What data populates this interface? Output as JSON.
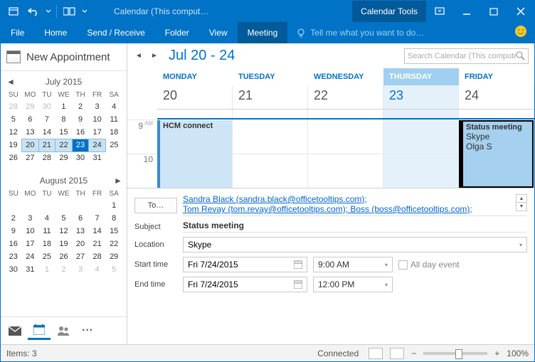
{
  "title": "Calendar (This comput…",
  "context_tab": "Calendar Tools",
  "ribbon": {
    "tabs": [
      "File",
      "Home",
      "Send / Receive",
      "Folder",
      "View",
      "Meeting"
    ],
    "active": "Meeting",
    "tellme": "Tell me what you want to do…"
  },
  "left": {
    "new": "New Appointment",
    "cal1": {
      "title": "July 2015",
      "dow": [
        "SU",
        "MO",
        "TU",
        "WE",
        "TH",
        "FR",
        "SA"
      ],
      "cells": [
        [
          "28",
          "29",
          "30",
          "1",
          "2",
          "3",
          "4"
        ],
        [
          "5",
          "6",
          "7",
          "8",
          "9",
          "10",
          "11"
        ],
        [
          "12",
          "13",
          "14",
          "15",
          "16",
          "17",
          "18"
        ],
        [
          "19",
          "20",
          "21",
          "22",
          "23",
          "24",
          "25"
        ],
        [
          "26",
          "27",
          "28",
          "29",
          "30",
          "31",
          ""
        ]
      ]
    },
    "cal2": {
      "title": "August 2015",
      "dow": [
        "SU",
        "MO",
        "TU",
        "WE",
        "TH",
        "FR",
        "SA"
      ],
      "cells": [
        [
          "",
          "",
          "",
          "",
          "",
          "",
          "1"
        ],
        [
          "2",
          "3",
          "4",
          "5",
          "6",
          "7",
          "8"
        ],
        [
          "9",
          "10",
          "11",
          "12",
          "13",
          "14",
          "15"
        ],
        [
          "16",
          "17",
          "18",
          "19",
          "20",
          "21",
          "22"
        ],
        [
          "23",
          "24",
          "25",
          "26",
          "27",
          "28",
          "29"
        ],
        [
          "30",
          "31",
          "1",
          "2",
          "3",
          "4",
          "5"
        ]
      ]
    }
  },
  "week": {
    "range": "Jul 20 - 24",
    "search": "Search Calendar (This computer only) (…",
    "days": [
      "MONDAY",
      "TUESDAY",
      "WEDNESDAY",
      "THURSDAY",
      "FRIDAY"
    ],
    "nums": [
      "20",
      "21",
      "22",
      "23",
      "24"
    ],
    "times": {
      "t1": "9",
      "t1s": "AM",
      "t2": "10"
    },
    "evt1": {
      "title": "HCM connect"
    },
    "evt2": {
      "title": "Status meeting",
      "loc": "Skype",
      "who": "Olga S"
    }
  },
  "form": {
    "to_label": "To…",
    "to_val": "Sandra Black (sandra.black@officetooltips.com);",
    "to_val2": "Tom Revay (tom.revay@officetooltips.com); Boss (boss@officetooltips.com);",
    "subject_label": "Subject",
    "subject": "Status meeting",
    "location_label": "Location",
    "location": "Skype",
    "start_label": "Start time",
    "end_label": "End time",
    "start_date": "Fri 7/24/2015",
    "end_date": "Fri 7/24/2015",
    "start_time": "9:00 AM",
    "end_time": "12:00 PM",
    "allday": "All day event"
  },
  "status": {
    "items": "Items: 3",
    "conn": "Connected",
    "zoom": "100%"
  }
}
